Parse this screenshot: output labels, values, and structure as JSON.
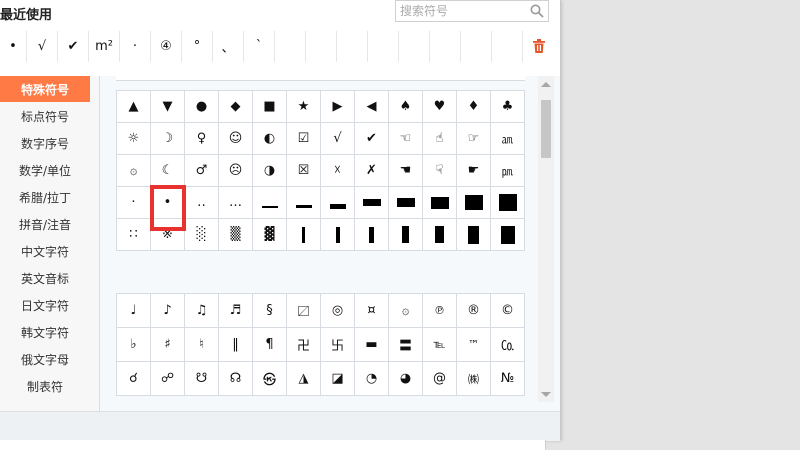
{
  "header": {
    "title": "最近使用"
  },
  "search": {
    "placeholder": "搜索符号"
  },
  "recent": [
    "•",
    "√",
    "✔",
    "m²",
    "·",
    "④",
    "°",
    "、",
    "`"
  ],
  "sidebar": {
    "items": [
      {
        "label": "特殊符号",
        "active": true
      },
      {
        "label": "标点符号"
      },
      {
        "label": "数字序号"
      },
      {
        "label": "数学/单位"
      },
      {
        "label": "希腊/拉丁"
      },
      {
        "label": "拼音/注音"
      },
      {
        "label": "中文字符"
      },
      {
        "label": "英文音标"
      },
      {
        "label": "日文字符"
      },
      {
        "label": "韩文字符"
      },
      {
        "label": "俄文字母"
      },
      {
        "label": "制表符"
      }
    ]
  },
  "grid1": [
    [
      "▲",
      "▼",
      "●",
      "◆",
      "■",
      "★",
      "▶",
      "◀",
      "♠",
      "♥",
      "♦",
      "♣"
    ],
    [
      "☼",
      "☽",
      "♀",
      "☺",
      "◐",
      "☑",
      "√",
      "✔",
      "☜",
      "☝",
      "☞",
      "㏂"
    ],
    [
      "۞",
      "☾",
      "♂",
      "☹",
      "◑",
      "☒",
      "☓",
      "✗",
      "☚",
      "☟",
      "☛",
      "㏘"
    ],
    [
      "·",
      "•",
      "‥",
      "…",
      "bar1",
      "bar2",
      "bar3",
      "bar4",
      "bar5",
      "bar6",
      "bar7",
      "bar8"
    ],
    [
      "∷",
      "※",
      "░",
      "▒",
      "▓",
      "vbar1",
      "vbar2",
      "vbar3",
      "vbar4",
      "vbar5",
      "vbar6",
      "vbar7"
    ]
  ],
  "grid2": [
    [
      "♩",
      "♪",
      "♫",
      "♬",
      "§",
      "〼",
      "◎",
      "¤",
      "۞",
      "℗",
      "®",
      "©"
    ],
    [
      "♭",
      "♯",
      "♮",
      "‖",
      "¶",
      "卍",
      "卐",
      "▬",
      "〓",
      "℡",
      "™",
      "㏇"
    ],
    [
      "☌",
      "☍",
      "☋",
      "☊",
      "㉿",
      "◮",
      "◪",
      "◔",
      "◕",
      "@",
      "㈱",
      "№"
    ]
  ],
  "colors": {
    "accent": "#ff7a45",
    "highlight": "#e8322f",
    "trash": "#e8542a"
  },
  "icons": {
    "search": "search-icon",
    "trash": "trash-icon",
    "scroll_up": "chevron-up-icon",
    "scroll_down": "chevron-down-icon"
  }
}
